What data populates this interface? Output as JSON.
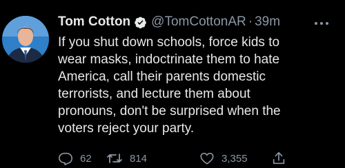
{
  "tweet": {
    "author_name": "Tom Cotton",
    "handle": "@TomCottonAR",
    "separator": "·",
    "time": "39m",
    "text": "If you shut down schools, force kids to\nwear masks, indoctrinate them to hate\nAmerica, call their parents domestic\nterrorists, and lecture them about\npronouns, don't be surprised when the\nvoters reject your party."
  },
  "actions": {
    "replies": "62",
    "retweets": "814",
    "likes": "3,355"
  },
  "icons": {
    "verified": "verified-badge-icon",
    "more": "more-horizontal-icon",
    "reply": "reply-icon",
    "retweet": "retweet-icon",
    "like": "heart-icon",
    "share": "share-icon"
  },
  "colors": {
    "background": "#000000",
    "primary_text": "#e7e9ea",
    "secondary_text": "#8b98a5",
    "verified": "#1d9bf0"
  }
}
